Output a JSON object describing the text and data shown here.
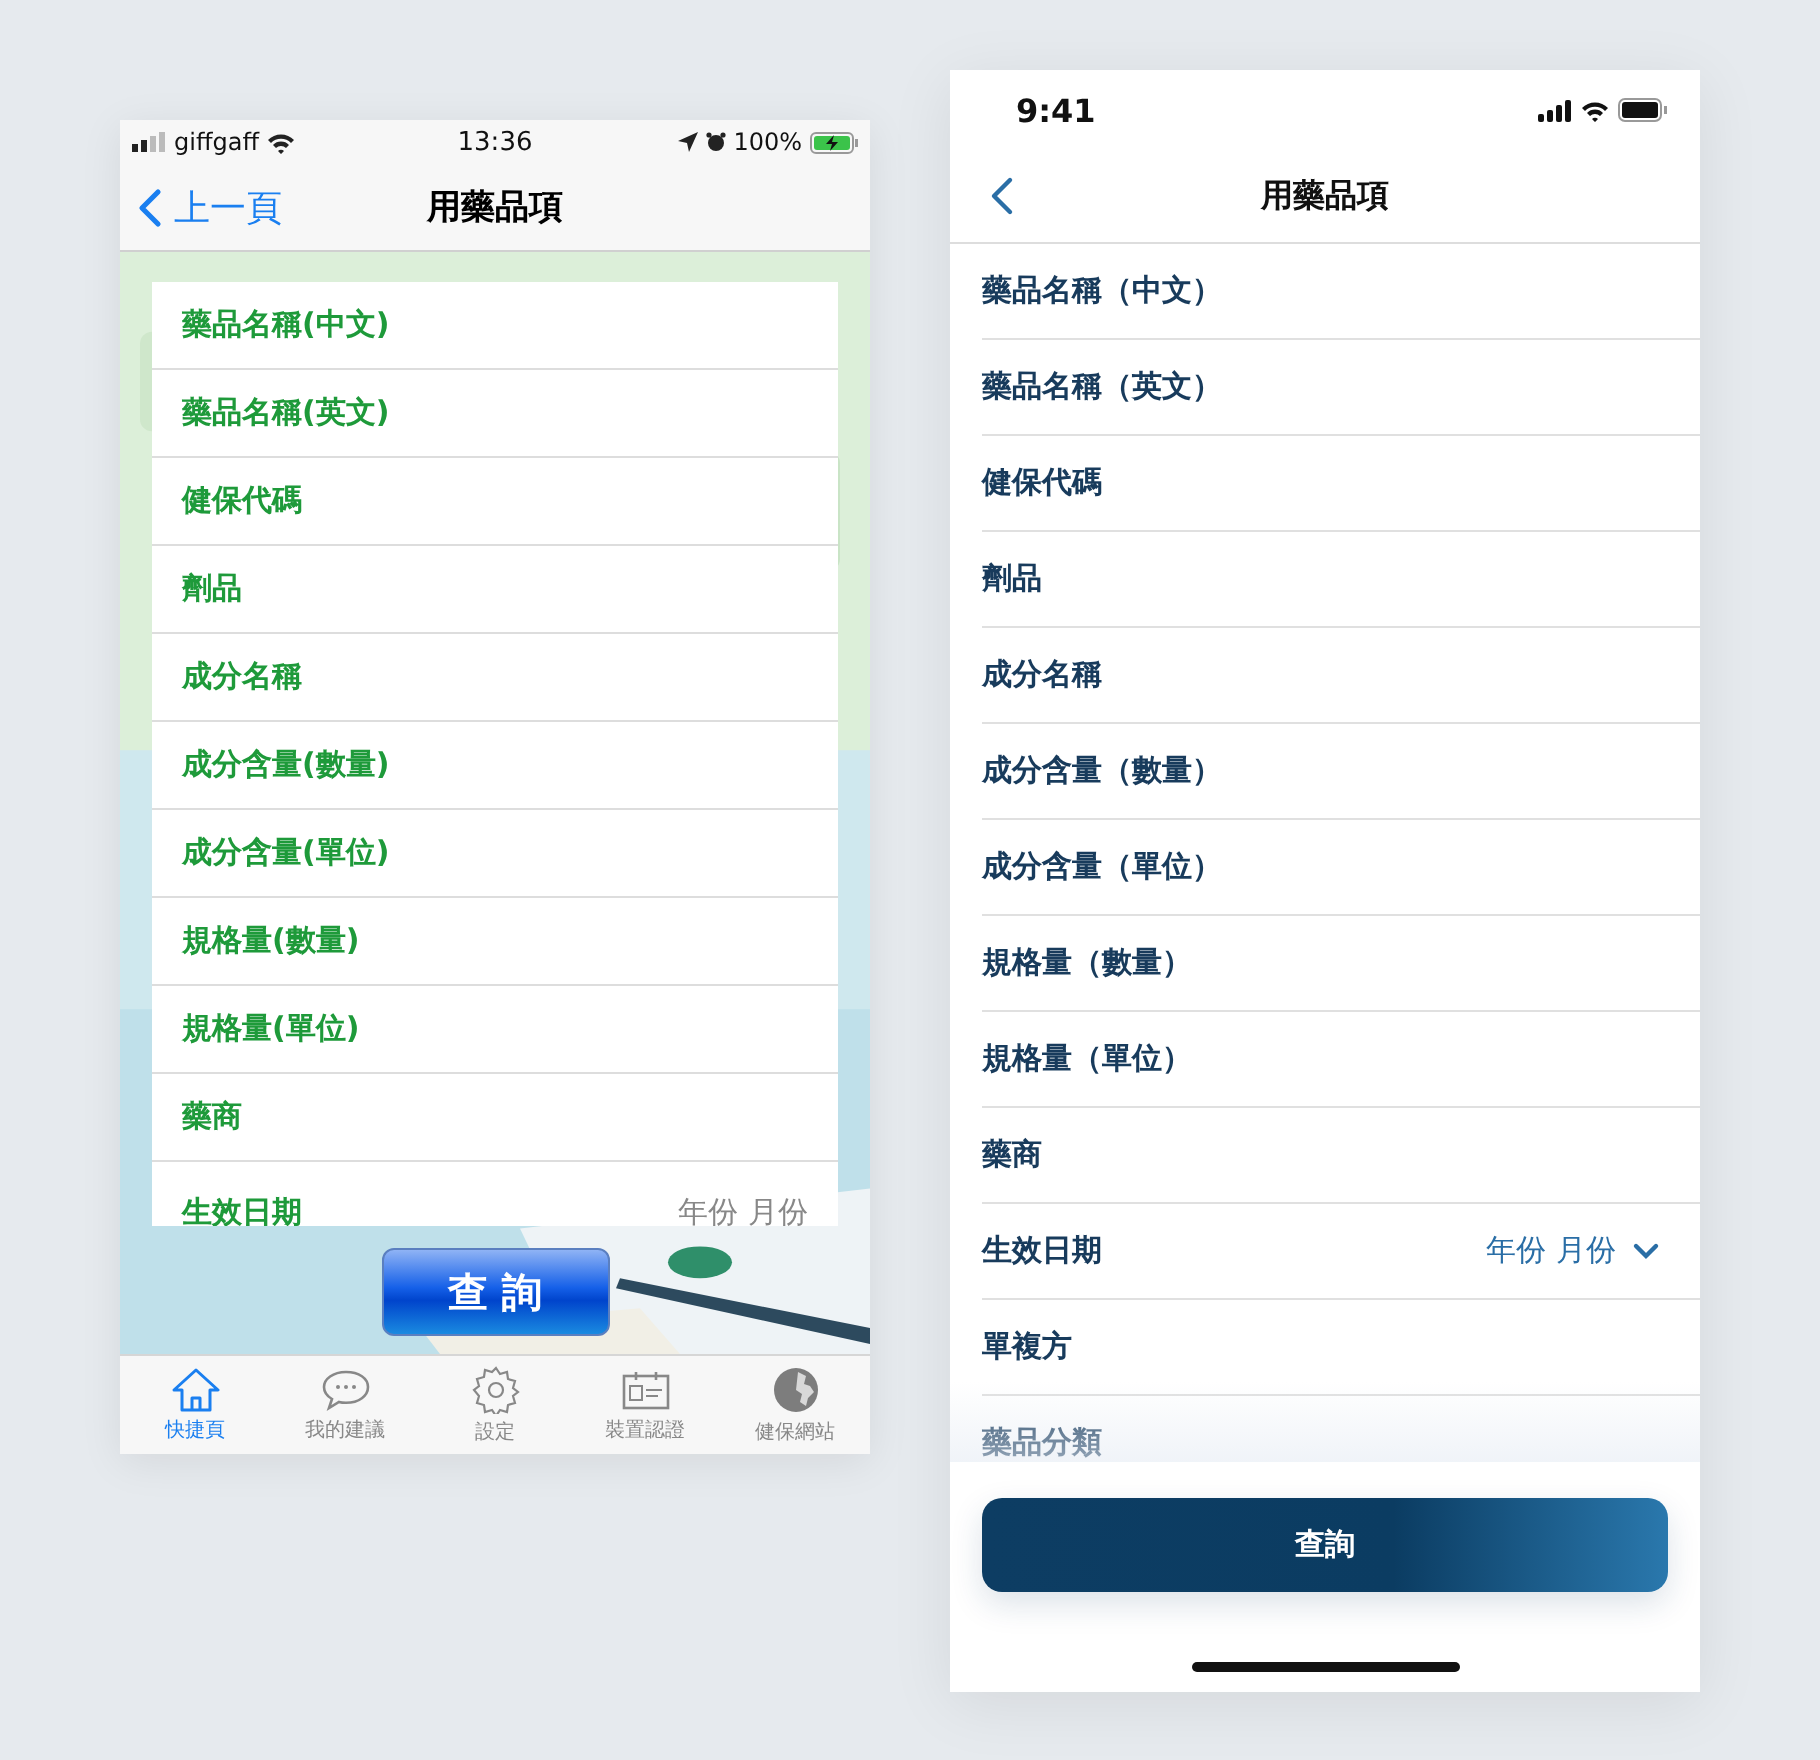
{
  "left_screen": {
    "status_bar": {
      "carrier": "giffgaff",
      "time": "13:36",
      "battery": "100%"
    },
    "nav": {
      "back": "上一頁",
      "title": "用藥品項"
    },
    "rows": [
      {
        "label": "藥品名稱(中文)"
      },
      {
        "label": "藥品名稱(英文)"
      },
      {
        "label": "健保代碼"
      },
      {
        "label": "劑品"
      },
      {
        "label": "成分名稱"
      },
      {
        "label": "成分含量(數量)"
      },
      {
        "label": "成分含量(單位)"
      },
      {
        "label": "規格量(數量)"
      },
      {
        "label": "規格量(單位)"
      },
      {
        "label": "藥商"
      },
      {
        "label": "生效日期",
        "value": "年份 月份"
      }
    ],
    "query_button": "查 詢",
    "tabs": [
      {
        "label": "快捷頁",
        "kind": "home",
        "selected": true
      },
      {
        "label": "我的建議",
        "kind": "chat",
        "selected": false
      },
      {
        "label": "設定",
        "kind": "settings",
        "selected": false
      },
      {
        "label": "裝置認證",
        "kind": "card",
        "selected": false
      },
      {
        "label": "健保網站",
        "kind": "globe",
        "selected": false
      }
    ]
  },
  "right_screen": {
    "status_bar": {
      "time": "9:41"
    },
    "nav": {
      "title": "用藥品項"
    },
    "rows": [
      {
        "label": "藥品名稱（中文）"
      },
      {
        "label": "藥品名稱（英文）"
      },
      {
        "label": "健保代碼"
      },
      {
        "label": "劑品"
      },
      {
        "label": "成分名稱"
      },
      {
        "label": "成分含量（數量）"
      },
      {
        "label": "成分含量（單位）"
      },
      {
        "label": "規格量（數量）"
      },
      {
        "label": "規格量（單位）"
      },
      {
        "label": "藥商"
      },
      {
        "label": "生效日期",
        "value": "年份 月份"
      },
      {
        "label": "單複方"
      },
      {
        "label": "藥品分類"
      }
    ],
    "query_button": "查詢"
  }
}
